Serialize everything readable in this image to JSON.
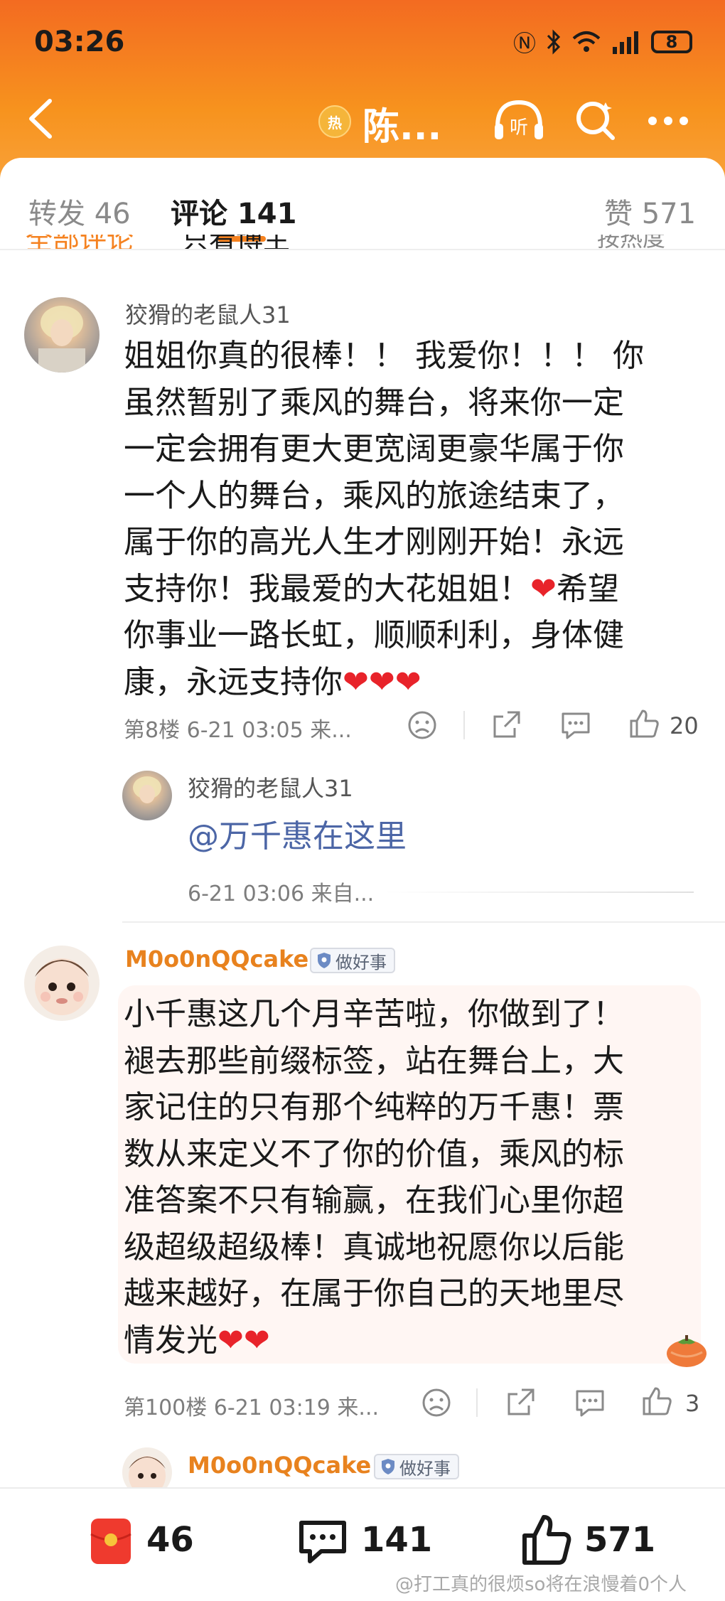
{
  "status_bar": {
    "time": "03:26",
    "battery": "8"
  },
  "nav": {
    "hot_badge": "热",
    "title": "陈..."
  },
  "tabs": {
    "repost": "转发 46",
    "comments": "评论 141",
    "likes": "赞 571"
  },
  "subtabs": {
    "all": "全部评论",
    "op_only": "只看博主",
    "sort": "按热度"
  },
  "comments": [
    {
      "username": "狡猾的老鼠人31",
      "text": "姐姐你真的很棒！！ 我爱你！！！ 你\n虽然暂别了乘风的舞台，将来你一定\n一定会拥有更大更宽阔更豪华属于你\n一个人的舞台，乘风的旅途结束了，\n属于你的高光人生才刚刚开始！永远\n支持你！我最爱的大花姐姐！❤希望\n你事业一路长虹，顺顺利利，身体健\n康，永远支持你❤❤❤",
      "meta": "第8楼 6-21 03:05 来...",
      "likes": "20",
      "reply": {
        "username": "狡猾的老鼠人31",
        "text": "@万千惠在这里",
        "meta": "6-21 03:06 来自..."
      }
    },
    {
      "username": "M0o0nQQcake",
      "badge": "做好事",
      "text": "小千惠这几个月辛苦啦，你做到了！\n褪去那些前缀标签，站在舞台上，大\n家记住的只有那个纯粹的万千惠！票\n数从来定义不了你的价值，乘风的标\n准答案不只有输赢，在我们心里你超\n级超级超级棒！真诚地祝愿你以后能\n越来越好，在属于你自己的天地里尽\n情发光❤❤",
      "meta": "第100楼 6-21 03:19 来...",
      "likes": "3",
      "reply": {
        "username": "M0o0nQQcake",
        "badge": "做好事"
      }
    }
  ],
  "bottom_bar": {
    "repost_count": "46",
    "comment_count": "141",
    "like_count": "571"
  },
  "watermark": "@打工真的很烦so将在浪慢着0个人",
  "colors": {
    "accent": "#f58220",
    "header_top": "#f36b21",
    "heart": "#e8232a",
    "link": "#4c66a6"
  }
}
